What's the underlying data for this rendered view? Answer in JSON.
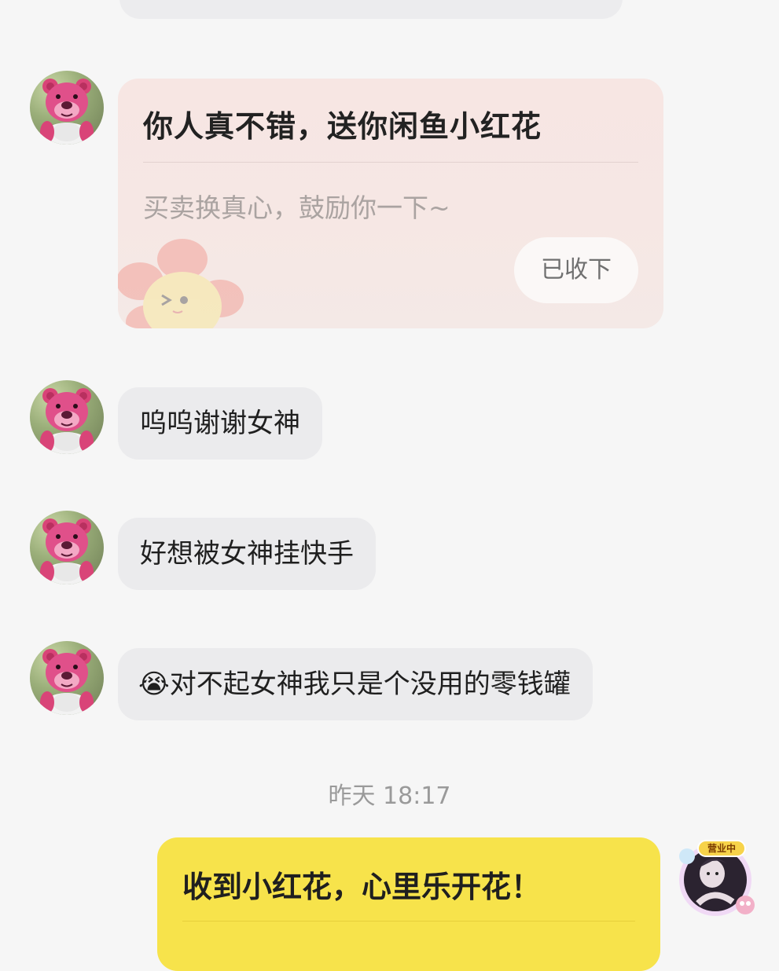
{
  "messages": [
    {
      "type": "flower_card",
      "title": "你人真不错，送你闲鱼小红花",
      "subtitle": "买卖换真心，鼓励你一下~",
      "button_label": "已收下"
    },
    {
      "type": "text",
      "text": "呜呜谢谢女神"
    },
    {
      "type": "text",
      "text": "好想被女神挂快手"
    },
    {
      "type": "text",
      "emoji": "😭",
      "text": "对不起女神我只是个没用的零钱罐"
    }
  ],
  "timestamp": "昨天 18:17",
  "sent_card": {
    "title": "收到小红花，心里乐开花！"
  },
  "self_avatar": {
    "badge": "营业中"
  },
  "icons": {
    "contact_avatar": "pink-bear-avatar",
    "emoji": "crying-face-emoji"
  },
  "colors": {
    "background": "#f6f6f6",
    "received_bubble": "#ebebed",
    "flower_card": "#f7e6e3",
    "sent_card": "#f7e34b"
  }
}
